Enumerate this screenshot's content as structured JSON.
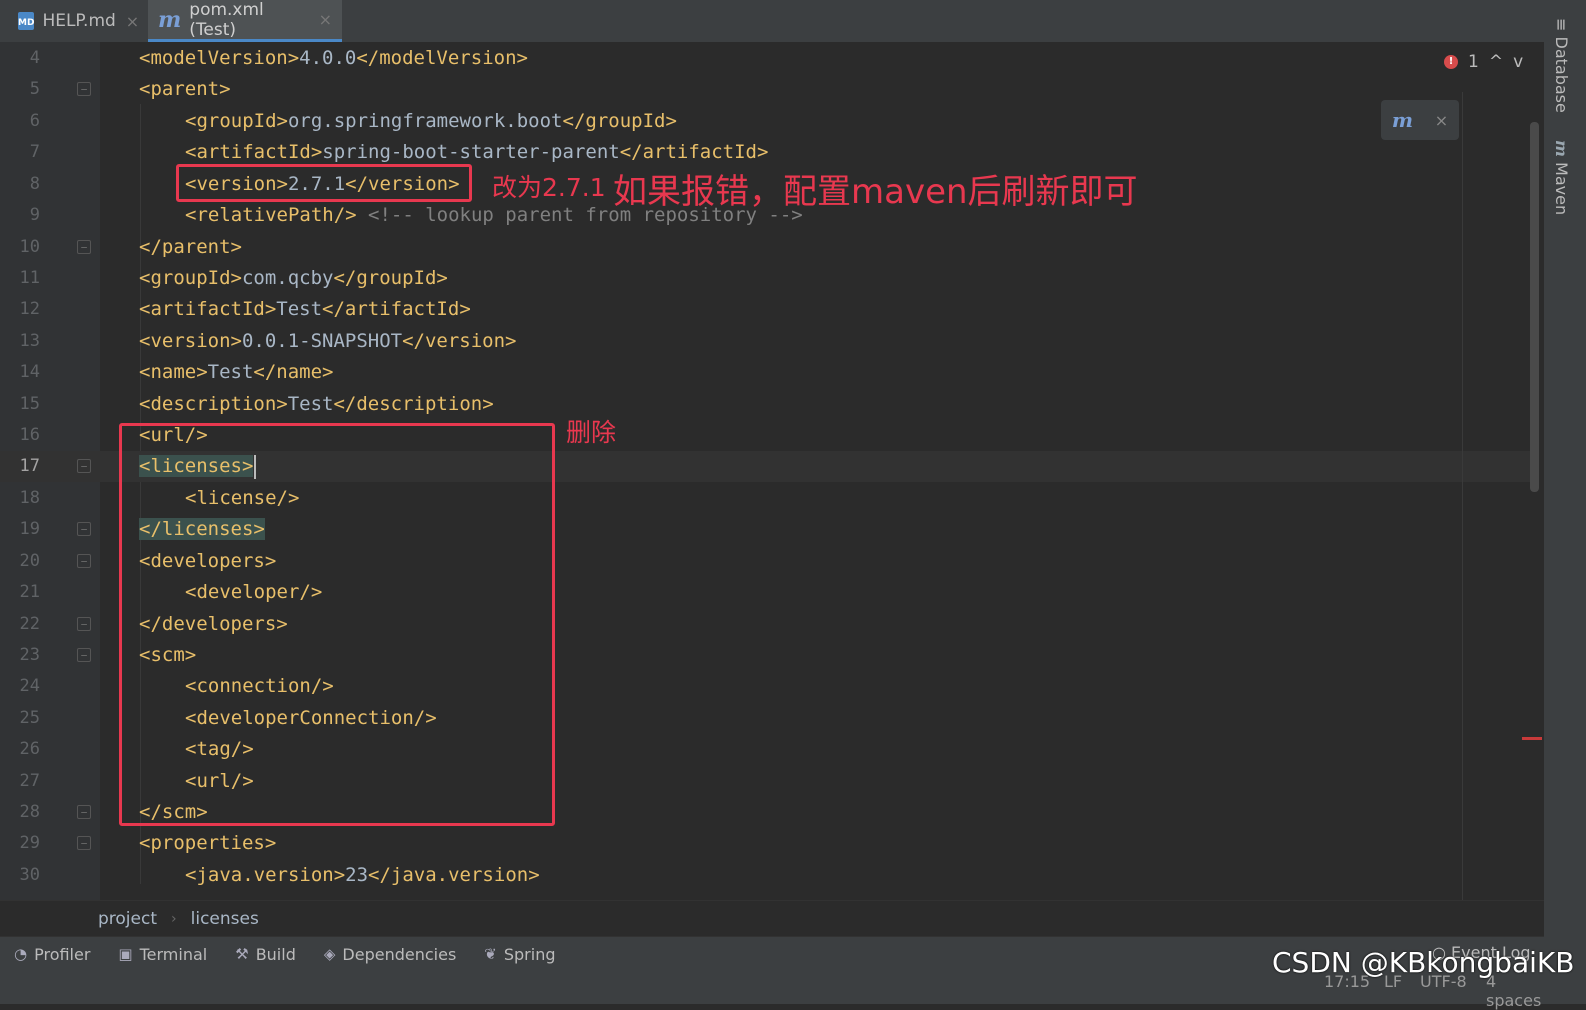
{
  "tabs": [
    {
      "label": "HELP.md",
      "icon": "markdown-file-icon",
      "icon_text": "MD",
      "active": false
    },
    {
      "label": "pom.xml (Test)",
      "icon": "maven-file-icon",
      "icon_text": "m",
      "active": true
    }
  ],
  "close_glyph": "×",
  "editor": {
    "lines": [
      {
        "n": "4",
        "code": "<modelVersion>4.0.0</modelVersion>"
      },
      {
        "n": "5",
        "code": "<parent>"
      },
      {
        "n": "6",
        "code": "<groupId>org.springframework.boot</groupId>"
      },
      {
        "n": "7",
        "code": "<artifactId>spring-boot-starter-parent</artifactId>"
      },
      {
        "n": "8",
        "code": "<version>2.7.1</version>"
      },
      {
        "n": "9",
        "code": "<relativePath/>",
        "comment": " <!-- lookup parent from repository -->"
      },
      {
        "n": "10",
        "code": "</parent>"
      },
      {
        "n": "11",
        "code": "<groupId>com.qcby</groupId>"
      },
      {
        "n": "12",
        "code": "<artifactId>Test</artifactId>"
      },
      {
        "n": "13",
        "code": "<version>0.0.1-SNAPSHOT</version>"
      },
      {
        "n": "14",
        "code": "<name>Test</name>"
      },
      {
        "n": "15",
        "code": "<description>Test</description>"
      },
      {
        "n": "16",
        "code": "<url/>"
      },
      {
        "n": "17",
        "code": "<licenses>"
      },
      {
        "n": "18",
        "code": "<license/>"
      },
      {
        "n": "19",
        "code": "</licenses>"
      },
      {
        "n": "20",
        "code": "<developers>"
      },
      {
        "n": "21",
        "code": "<developer/>"
      },
      {
        "n": "22",
        "code": "</developers>"
      },
      {
        "n": "23",
        "code": "<scm>"
      },
      {
        "n": "24",
        "code": "<connection/>"
      },
      {
        "n": "25",
        "code": "<developerConnection/>"
      },
      {
        "n": "26",
        "code": "<tag/>"
      },
      {
        "n": "27",
        "code": "<url/>"
      },
      {
        "n": "28",
        "code": "</scm>"
      },
      {
        "n": "29",
        "code": "<properties>"
      },
      {
        "n": "30",
        "code": "<java.version>23</java.version>"
      }
    ],
    "error_count": "1",
    "error_glyph": "!",
    "nav_up": "^",
    "nav_down": "v",
    "maven_reload_icon": "m",
    "maven_reload_close": "×"
  },
  "annotations": {
    "version_note": "改为2.7.1",
    "error_note": "如果报错，配置maven后刷新即可",
    "delete_note": "删除"
  },
  "right_panel": {
    "database_label": "Database",
    "maven_label": "Maven",
    "maven_icon_text": "m"
  },
  "breadcrumb": {
    "items": [
      "project",
      "licenses"
    ],
    "separator": "›"
  },
  "bottom_tools": [
    {
      "label": "Profiler",
      "icon": "profiler-icon"
    },
    {
      "label": "Terminal",
      "icon": "terminal-icon"
    },
    {
      "label": "Build",
      "icon": "hammer-icon"
    },
    {
      "label": "Dependencies",
      "icon": "layers-icon"
    },
    {
      "label": "Spring",
      "icon": "leaf-icon"
    }
  ],
  "event_log": "Event Log",
  "status": {
    "position": "17:15",
    "line_sep": "LF",
    "encoding": "UTF-8",
    "indent": "4 spaces"
  },
  "watermark": "CSDN @KBkongbaiKB",
  "colors": {
    "annotation_red": "#e8384f",
    "tag_color": "#e8bf6a",
    "highlight": "#3b514d"
  }
}
